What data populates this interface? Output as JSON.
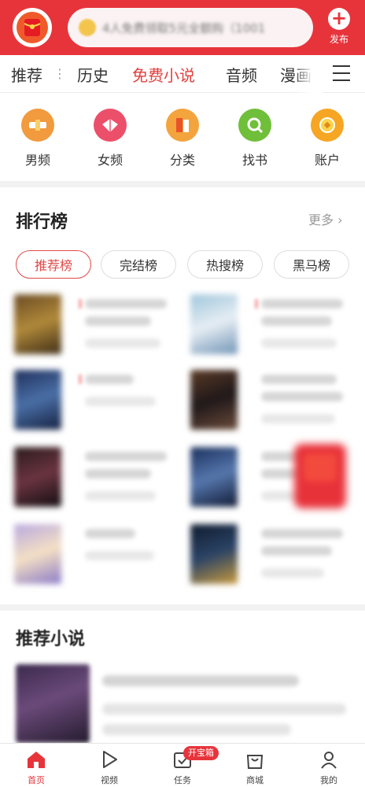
{
  "header": {
    "search_placeholder": "4人免费领取5元全额购（1001",
    "publish_label": "发布"
  },
  "tabs": [
    {
      "label": "推荐",
      "active": false
    },
    {
      "label": "历史",
      "active": false
    },
    {
      "label": "免费小说",
      "active": true
    },
    {
      "label": "音频",
      "active": false
    },
    {
      "label": "漫画",
      "active": false
    }
  ],
  "categories": [
    {
      "label": "男频",
      "icon": "male-channel-icon",
      "color": "#f19a3e"
    },
    {
      "label": "女频",
      "icon": "female-channel-icon",
      "color": "#ec4f6a"
    },
    {
      "label": "分类",
      "icon": "category-icon",
      "color": "#f4a43c"
    },
    {
      "label": "找书",
      "icon": "find-book-icon",
      "color": "#6fbf3a"
    },
    {
      "label": "账户",
      "icon": "account-icon",
      "color": "#f6a623"
    }
  ],
  "ranking": {
    "title": "排行榜",
    "more": "更多 ›",
    "pills": [
      {
        "label": "推荐榜",
        "active": true
      },
      {
        "label": "完结榜",
        "active": false
      },
      {
        "label": "热搜榜",
        "active": false
      },
      {
        "label": "黑马榜",
        "active": false
      }
    ]
  },
  "recommend": {
    "title": "推荐小说"
  },
  "bottom_nav": [
    {
      "label": "首页",
      "active": true
    },
    {
      "label": "视频",
      "active": false
    },
    {
      "label": "任务",
      "active": false
    },
    {
      "label": "商城",
      "active": false
    },
    {
      "label": "我的",
      "active": false
    }
  ],
  "task_badge": "开宝箱",
  "colors": {
    "brand_red": "#e7343b",
    "tab_active": "#e2403f"
  }
}
